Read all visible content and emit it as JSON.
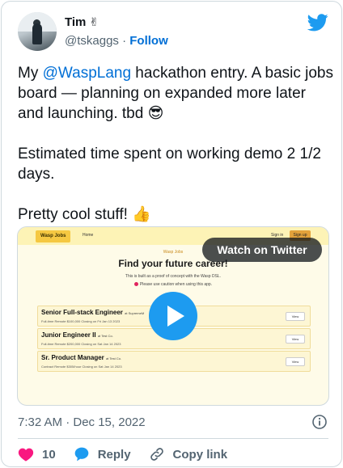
{
  "author": {
    "name": "Tim",
    "name_emoji": "✌",
    "handle": "@tskaggs",
    "separator": "·",
    "follow_label": "Follow"
  },
  "tweet": {
    "text_prefix": "My ",
    "mention": "@WaspLang",
    "text_body": " hackathon entry. A basic jobs board — planning on expanded more later and launching. tbd 😎\n\nEstimated time spent on working demo 2 1/2 days.\n\nPretty cool stuff! 👍"
  },
  "media": {
    "watch_label": "Watch on Twitter",
    "app": {
      "logo": "Wasp Jobs",
      "nav_home": "Home",
      "nav_signin": "Sign in",
      "nav_signup": "Sign up",
      "brand": "Wasp Jobs",
      "title": "Find your future career!",
      "sub1": "This is built as a proof of concept with the Wasp DSL.",
      "sub2": "Please use caution when using this app.",
      "view_label": "View",
      "jobs": [
        {
          "title": "Senior Full-stack Engineer",
          "company": "at SupremeM",
          "meta": "Full-time   Remote   $100,000   Closing on Fri Jan 13 2023"
        },
        {
          "title": "Junior Engineer II",
          "company": "at Test Co.",
          "meta": "Full-time   Remote   $200,000   Closing on Sat Jan 14 2023"
        },
        {
          "title": "Sr. Product Manager",
          "company": "at Test Co.",
          "meta": "Contract   Remote   $305/hour   Closing on Sat Jan 14 2023"
        }
      ]
    }
  },
  "timestamp": "7:32 AM · Dec 15, 2022",
  "actions": {
    "like_count": "10",
    "reply_label": "Reply",
    "copy_label": "Copy link"
  },
  "colors": {
    "link": "#006fd6",
    "twitter_blue": "#1d9bf0",
    "like_pink": "#f91880"
  }
}
